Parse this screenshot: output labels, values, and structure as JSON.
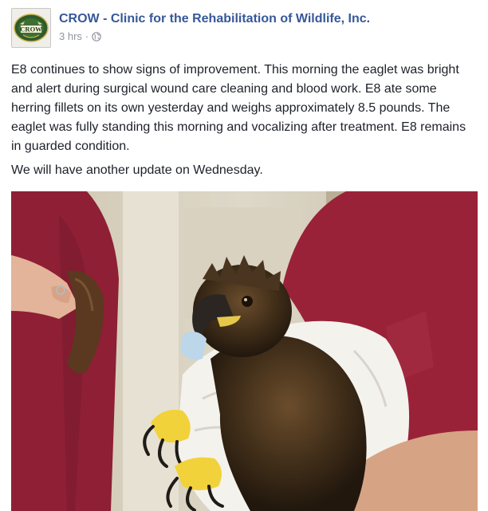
{
  "post": {
    "page_name": "CROW - Clinic for the Rehabilitation of Wildlife, Inc.",
    "avatar_text": "CROW",
    "timestamp": "3 hrs",
    "separator": "·",
    "privacy_icon": "globe-icon",
    "paragraphs": [
      "E8 continues to show signs of improvement. This morning the eaglet was bright and alert during surgical wound care cleaning and blood work. E8 ate some herring fillets on its own yesterday and weighs approximately 8.5 pounds. The eaglet was fully standing this morning and vocalizing after treatment. E8 remains in guarded condition.",
      "We will have another update on Wednesday."
    ],
    "photo_subject": "eaglet-held-in-towel-by-clinic-staff"
  },
  "colors": {
    "link": "#365899",
    "text": "#1d2129",
    "muted": "#90949c",
    "scrubs": "#8e1f35",
    "avatar_green": "#2f5a2a"
  }
}
